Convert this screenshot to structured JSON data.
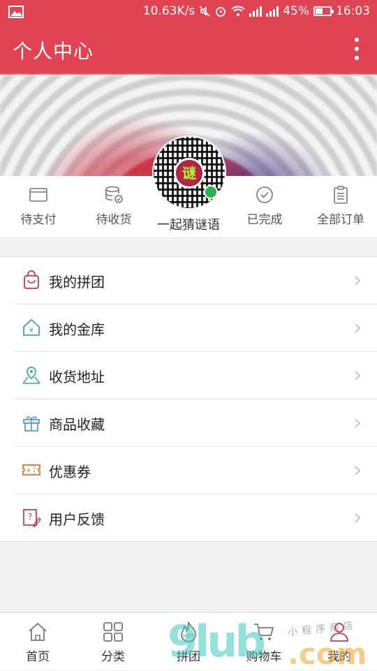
{
  "status_bar": {
    "speed": "10.63K/s",
    "battery": "45%",
    "time": "16:03",
    "icons": [
      "picture-icon",
      "mute-icon",
      "alarm-icon",
      "wifi-icon",
      "signal-icon",
      "signal-icon",
      "battery-icon"
    ]
  },
  "app_bar": {
    "title": "个人中心",
    "menu_icon": "more-vertical-icon"
  },
  "orders": {
    "items": [
      {
        "label": "待支付",
        "icon": "card-icon"
      },
      {
        "label": "待收货",
        "icon": "coins-icon"
      },
      {
        "label": "已完成",
        "icon": "check-circle-icon"
      },
      {
        "label": "全部订单",
        "icon": "clipboard-icon"
      }
    ],
    "mini_program": {
      "label": "一起猜谜语",
      "center_char": "谜"
    }
  },
  "menu": {
    "items": [
      {
        "label": "我的拼团",
        "icon": "shopping-bag-icon"
      },
      {
        "label": "我的金库",
        "icon": "vault-house-icon"
      },
      {
        "label": "收货地址",
        "icon": "map-pin-icon"
      },
      {
        "label": "商品收藏",
        "icon": "gift-icon"
      },
      {
        "label": "优惠券",
        "icon": "coupon-icon"
      },
      {
        "label": "用户反馈",
        "icon": "feedback-icon"
      }
    ]
  },
  "tabbar": {
    "items": [
      {
        "label": "首页",
        "icon": "home-icon"
      },
      {
        "label": "分类",
        "icon": "grid-icon"
      },
      {
        "label": "拼团",
        "icon": "hot-icon"
      },
      {
        "label": "购物车",
        "icon": "cart-icon"
      },
      {
        "label": "我的",
        "icon": "user-icon"
      }
    ]
  },
  "watermark": {
    "brand": "9lub",
    "domain": ".com",
    "tagline": "小程序商店"
  },
  "colors": {
    "brand_red": "#e04352",
    "icon_red": "#c9394a",
    "icon_teal": "#3aa9a0",
    "icon_blue": "#5a9bd5",
    "icon_orange": "#e0703a"
  }
}
